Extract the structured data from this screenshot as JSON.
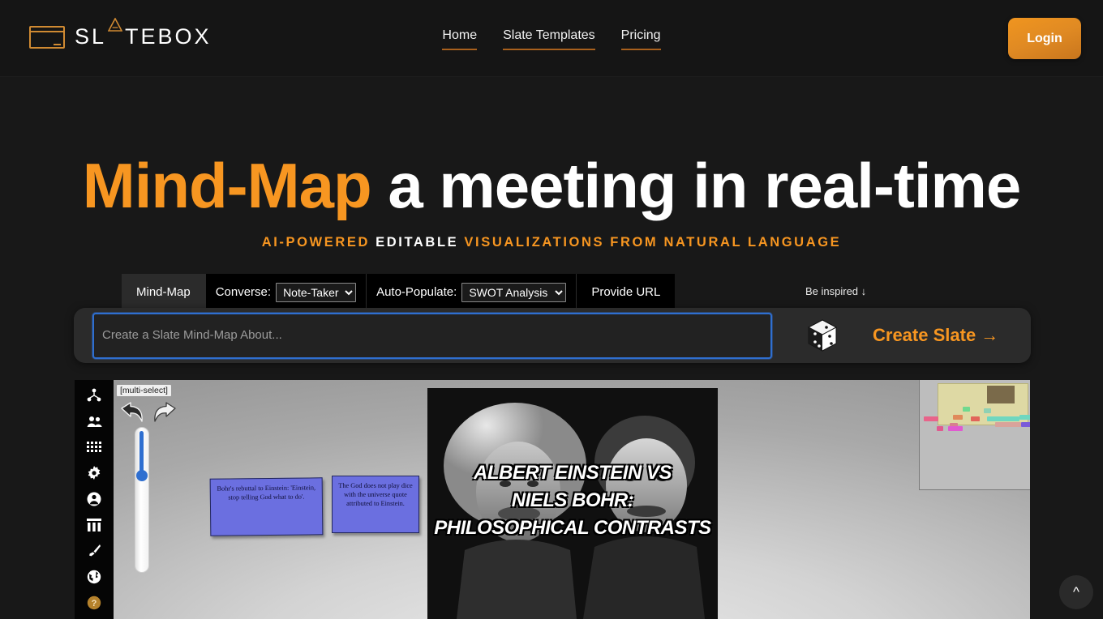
{
  "header": {
    "logo": {
      "text": "SLATEBOX",
      "icon": "slate-frame-icon",
      "accent_color": "#d08a32"
    },
    "nav": [
      {
        "label": "Home",
        "name": "home"
      },
      {
        "label": "Slate Templates",
        "name": "slate-templates"
      },
      {
        "label": "Pricing",
        "name": "pricing"
      }
    ],
    "login_label": "Login"
  },
  "hero": {
    "title_accent": "Mind-Map",
    "title_rest": " a meeting in real-time",
    "subtitle_part1": "AI-POWERED ",
    "subtitle_part2": "EDITABLE ",
    "subtitle_part3": "VISUALIZATIONS FROM NATURAL LANGUAGE",
    "accent_color": "#f79621"
  },
  "tabs": {
    "mindmap_label": "Mind-Map",
    "converse_label": "Converse:",
    "converse_value": "Note-Taker",
    "converse_options": [
      "Note-Taker"
    ],
    "autopopulate_label": "Auto-Populate:",
    "autopopulate_value": "SWOT Analysis",
    "autopopulate_options": [
      "SWOT Analysis"
    ],
    "provide_url_label": "Provide URL",
    "be_inspired_label": "Be inspired ↓"
  },
  "prompt": {
    "placeholder": "Create a Slate Mind-Map About...",
    "value": "",
    "dice_icon": "dice-icon",
    "create_label": "Create Slate →"
  },
  "canvas": {
    "toolbar_icons": [
      "sitemap-icon",
      "users-icon",
      "grid-icon",
      "gear-icon",
      "account-icon",
      "table-columns-icon",
      "brush-icon",
      "globe-icon",
      "help-icon"
    ],
    "multi_select_label": "[multi-select]",
    "undo_icon": "undo-arrow-icon",
    "redo_icon": "redo-arrow-icon",
    "zoom_slider": {
      "name": "zoom-slider",
      "value_percent": 30
    },
    "notes": [
      {
        "text": "Bohr's rebuttal to Einstein: 'Einstein, stop telling God what to do'.",
        "color": "#6b6fe0"
      },
      {
        "text": "The God does not play dice with the universe quote attributed to Einstein.",
        "color": "#6b6fe0"
      }
    ],
    "photo_title_lines": [
      "ALBERT EINSTEIN VS",
      "NIELS BOHR:",
      "PHILOSOPHICAL CONTRASTS"
    ],
    "minimap_name": "minimap"
  },
  "scroll_top_icon": "chevron-up-icon"
}
